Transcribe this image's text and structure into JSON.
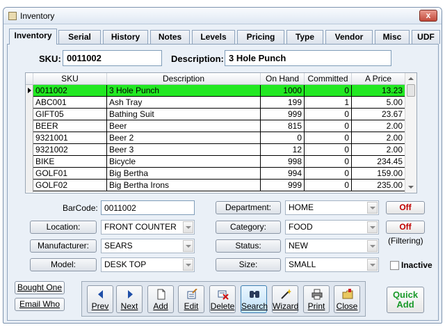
{
  "window": {
    "title": "Inventory",
    "close": "x"
  },
  "tabs": [
    {
      "label": "Inventory"
    },
    {
      "label": "Serial"
    },
    {
      "label": "History"
    },
    {
      "label": "Notes"
    },
    {
      "label": "Levels"
    },
    {
      "label": "Pricing"
    },
    {
      "label": "Type"
    },
    {
      "label": "Vendor"
    },
    {
      "label": "Misc"
    },
    {
      "label": "UDF"
    }
  ],
  "header": {
    "sku_label": "SKU:",
    "sku_value": "0011002",
    "desc_label": "Description:",
    "desc_value": "3 Hole Punch"
  },
  "grid": {
    "columns": [
      "SKU",
      "Description",
      "On Hand",
      "Committed",
      "A Price"
    ],
    "rows": [
      {
        "sku": "0011002",
        "desc": "3 Hole Punch",
        "onhand": "1000",
        "committed": "0",
        "price": "13.23"
      },
      {
        "sku": "ABC001",
        "desc": "Ash Tray",
        "onhand": "199",
        "committed": "1",
        "price": "5.00"
      },
      {
        "sku": "GIFT05",
        "desc": "Bathing Suit",
        "onhand": "999",
        "committed": "0",
        "price": "23.67"
      },
      {
        "sku": "BEER",
        "desc": "Beer",
        "onhand": "815",
        "committed": "0",
        "price": "2.00"
      },
      {
        "sku": "9321001",
        "desc": "Beer 2",
        "onhand": "0",
        "committed": "0",
        "price": "2.00"
      },
      {
        "sku": "9321002",
        "desc": "Beer 3",
        "onhand": "12",
        "committed": "0",
        "price": "2.00"
      },
      {
        "sku": "BIKE",
        "desc": "Bicycle",
        "onhand": "998",
        "committed": "0",
        "price": "234.45"
      },
      {
        "sku": "GOLF01",
        "desc": "Big Bertha",
        "onhand": "994",
        "committed": "0",
        "price": "159.00"
      },
      {
        "sku": "GOLF02",
        "desc": "Big Bertha Irons",
        "onhand": "999",
        "committed": "0",
        "price": "235.00"
      }
    ],
    "selected_row_color": "#22e822"
  },
  "fields": {
    "barcode_label": "BarCode:",
    "barcode_value": "0011002",
    "location_label": "Location:",
    "location_value": "FRONT COUNTER",
    "manufacturer_label": "Manufacturer:",
    "manufacturer_value": "SEARS",
    "model_label": "Model:",
    "model_value": "DESK TOP",
    "department_label": "Department:",
    "department_value": "HOME",
    "category_label": "Category:",
    "category_value": "FOOD",
    "status_label": "Status:",
    "status_value": "NEW",
    "size_label": "Size:",
    "size_value": "SMALL"
  },
  "filters": {
    "off1": "Off",
    "off2": "Off",
    "filtering": "(Filtering)",
    "inactive": "Inactive"
  },
  "left_buttons": {
    "bought_one": "Bought One",
    "email_who": "Email Who"
  },
  "toolbar": [
    {
      "label": "Prev",
      "icon": "arrow-left-icon"
    },
    {
      "label": "Next",
      "icon": "arrow-right-icon"
    },
    {
      "label": "Add",
      "icon": "page-icon"
    },
    {
      "label": "Edit",
      "icon": "edit-icon"
    },
    {
      "label": "Delete",
      "icon": "delete-icon"
    },
    {
      "label": "Search",
      "icon": "binoculars-icon"
    },
    {
      "label": "Wizard",
      "icon": "wand-icon"
    },
    {
      "label": "Print",
      "icon": "printer-icon"
    },
    {
      "label": "Close",
      "icon": "folder-close-icon"
    }
  ],
  "quick_add": {
    "line1": "Quick",
    "line2": "Add"
  }
}
